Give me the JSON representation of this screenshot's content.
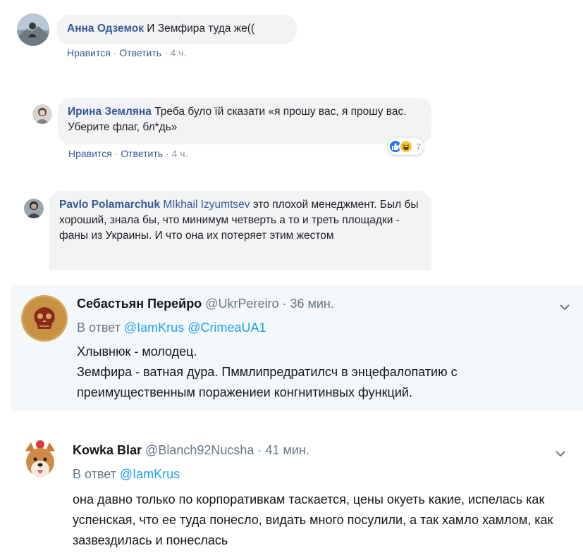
{
  "fb_comments": [
    {
      "author": "Анна Одземок",
      "text": " И Земфира туда же((",
      "actions": {
        "like": "Нравится",
        "sep": " · ",
        "reply": "Ответить",
        "time": "4 ч."
      }
    },
    {
      "author": "Ирина Земляна",
      "text": " Треба було їй сказати «я прошу вас, я прошу вас. Уберите флаг, бл*дь»",
      "actions": {
        "like": "Нравится",
        "sep": " · ",
        "reply": "Ответить",
        "time": "4 ч."
      },
      "reactions": {
        "count": "7"
      }
    },
    {
      "author": "Pavlo Polamarchuk",
      "mention": "MIkhail Izyumtsev",
      "text": " это плохой менеджмент. Был бы хороший, знала бы, что минимум четверть а то и треть площадки - фаны из Украины. И что она их потеряет этим жестом"
    }
  ],
  "tweets": [
    {
      "name": "Себастьян Перейро",
      "handle": " @UkrPereiro",
      "dot": " · ",
      "time": "36 мин.",
      "reply_prefix": "В ответ ",
      "reply_to_1": "@IamKrus",
      "reply_to_2": "@CrimeaUA1",
      "line1": "Хлывнюк - молодец.",
      "line2": "Земфира - ватная дура. Пммлипредратилсч в энцефалопатию с преимущественным поражениеи конгнитинвых функций."
    },
    {
      "name": "Kowka Blar",
      "handle": " @Blanch92Nucsha",
      "dot": " · ",
      "time": "41 мин.",
      "reply_prefix": "В ответ ",
      "reply_to_1": "@IamKrus",
      "text": "она давно только по корпоративкам таскается, цены окуеть какие, испелась как успенская, что ее туда понесло, видать много посулили, а так хамло хамлом, как зазвездилась и понеслась"
    }
  ],
  "colors": {
    "fb_link": "#385898",
    "fb_bubble": "#f2f3f5",
    "tw_link": "#1da1f2",
    "tw_gray": "#657786",
    "tw_highlight": "#f5f8fa"
  }
}
